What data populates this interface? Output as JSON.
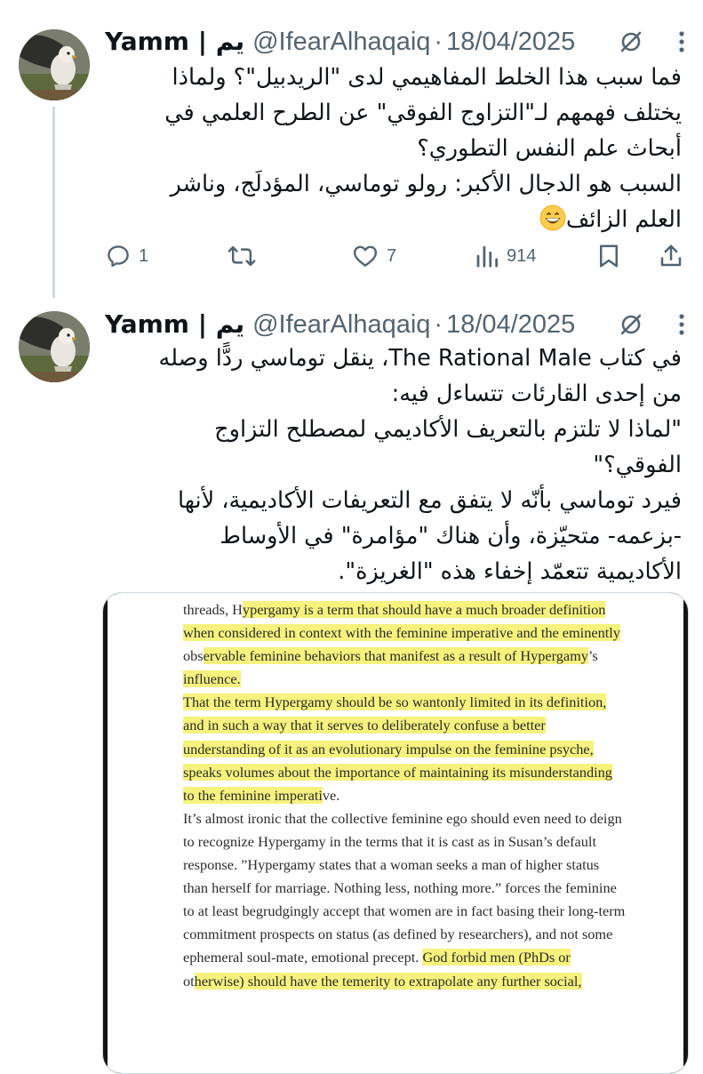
{
  "tweets": [
    {
      "author": {
        "display_name": "Yamm | يم",
        "handle": "@IfearAlhaqaiq",
        "separator": "·",
        "date": "18/04/2025"
      },
      "text_lines": [
        "فما سبب هذا الخلط المفاهيمي لدى \"الريدبيل\"؟ ولماذا",
        "يختلف فهمهم لـ\"التزاوج الفوقي\" عن الطرح العلمي في",
        "أبحاث علم النفس التطوري؟",
        "السبب هو الدجال الأكبر: رولو توماسي، المؤدلَج، وناشر",
        "العلم الزائف"
      ],
      "emoji": "grinning-face-emoji",
      "actions": {
        "reply_count": "1",
        "retweet_count": "",
        "like_count": "7",
        "view_count": "914"
      }
    },
    {
      "author": {
        "display_name": "Yamm | يم",
        "handle": "@IfearAlhaqaiq",
        "separator": "·",
        "date": "18/04/2025"
      },
      "text_lines": [
        "في كتاب The Rational Male، ينقل توماسي ردًّا وصله",
        "من إحدى القارئات تتساءل فيه:",
        "\"لماذا لا تلتزم بالتعريف الأكاديمي لمصطلح التزاوج",
        "الفوقي؟\"",
        "فيرد توماسي بأنّه لا يتفق مع التعريفات الأكاديمية، لأنها",
        "-بزعمه- متحيّزة، وأن هناك \"مؤامرة\" في الأوساط",
        "الأكاديمية تتعمّد إخفاء هذه \"الغريزة\"."
      ],
      "media": {
        "page_lines": [
          {
            "segments": [
              {
                "text": "threads, H",
                "hl": false
              },
              {
                "text": "ypergamy is a term that should have a much broader definition",
                "hl": true
              }
            ]
          },
          {
            "segments": [
              {
                "text": "when considered in context with the feminine imperative and the eminently",
                "hl": true
              }
            ]
          },
          {
            "segments": [
              {
                "text": "obs",
                "hl": false
              },
              {
                "text": "ervable feminine behaviors that manifest as a result of Hypergamy",
                "hl": true
              },
              {
                "text": "’s",
                "hl": false
              }
            ]
          },
          {
            "segments": [
              {
                "text": "influence.",
                "hl": true
              }
            ]
          },
          {
            "segments": [
              {
                "text": "That the term Hypergamy should be so wantonly limited in its definition,",
                "hl": true
              }
            ]
          },
          {
            "segments": [
              {
                "text": "and in such a way that it serves to deliberately confuse a better",
                "hl": true
              }
            ]
          },
          {
            "segments": [
              {
                "text": "understanding of it as an evolutionary impulse on the feminine psyche,",
                "hl": true
              }
            ]
          },
          {
            "segments": [
              {
                "text": "speaks volumes about the importance of maintaining its misunderstanding",
                "hl": true
              }
            ]
          },
          {
            "segments": [
              {
                "text": "to the feminine imperati",
                "hl": true
              },
              {
                "text": "ve.",
                "hl": false
              }
            ]
          },
          {
            "segments": [
              {
                "text": "It’s almost ironic that the collective feminine ego should even need to deign",
                "hl": false
              }
            ]
          },
          {
            "segments": [
              {
                "text": "to recognize Hypergamy in the terms that it is cast as in Susan’s default",
                "hl": false
              }
            ]
          },
          {
            "segments": [
              {
                "text": "response. ”Hypergamy states that a woman seeks a man of higher status",
                "hl": false
              }
            ]
          },
          {
            "segments": [
              {
                "text": "than herself for marriage. Nothing less, nothing more.” forces the feminine",
                "hl": false
              }
            ]
          },
          {
            "segments": [
              {
                "text": "to at least begrudgingly accept that women are in fact basing their long-term",
                "hl": false
              }
            ]
          },
          {
            "segments": [
              {
                "text": "commitment prospects on status (as defined by researchers), and not some",
                "hl": false
              }
            ]
          },
          {
            "segments": [
              {
                "text": "ephemeral soul-mate, emotional precept. ",
                "hl": false
              },
              {
                "text": "God forbid men (PhDs or",
                "hl": true
              }
            ]
          },
          {
            "segments": [
              {
                "text": "ot",
                "hl": false
              },
              {
                "text": "herwise) should have the temerity to extrapolate any further social,",
                "hl": true
              }
            ]
          }
        ]
      }
    }
  ],
  "colors": {
    "text_primary": "#0f1419",
    "text_secondary": "#536471",
    "divider": "#cfd9de",
    "highlight": "#f6f27d"
  }
}
